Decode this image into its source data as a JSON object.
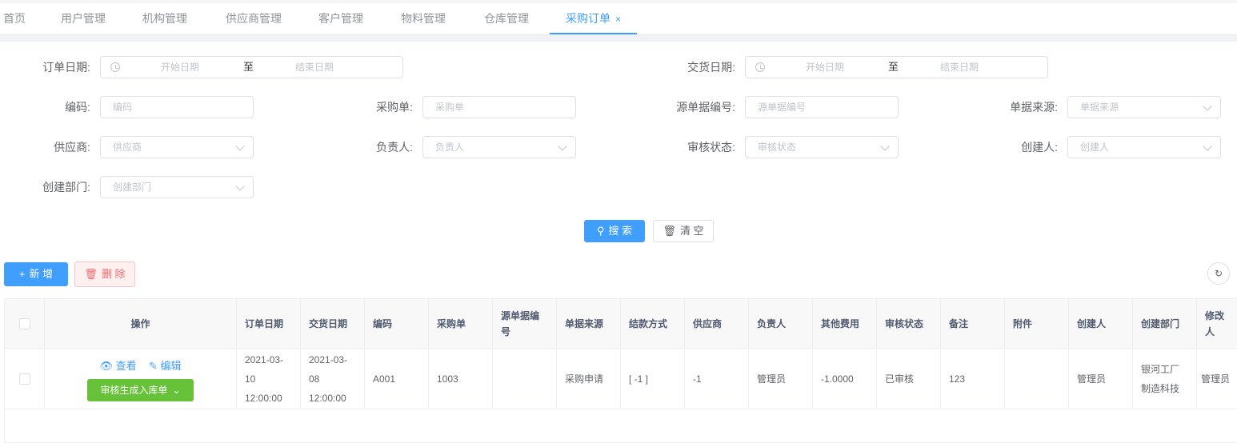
{
  "tabs": [
    {
      "label": "首页"
    },
    {
      "label": "用户管理"
    },
    {
      "label": "机构管理"
    },
    {
      "label": "供应商管理"
    },
    {
      "label": "客户管理"
    },
    {
      "label": "物料管理"
    },
    {
      "label": "仓库管理"
    },
    {
      "label": "采购订单",
      "close": "×"
    }
  ],
  "form": {
    "order_date": {
      "label": "订单日期:",
      "start": "开始日期",
      "sep": "至",
      "end": "结束日期"
    },
    "delivery_date": {
      "label": "交货日期:",
      "start": "开始日期",
      "sep": "至",
      "end": "结束日期"
    },
    "code": {
      "label": "编码:",
      "placeholder": "编码"
    },
    "purchase_no": {
      "label": "采购单:",
      "placeholder": "采购单"
    },
    "source_no": {
      "label": "源单据编号:",
      "placeholder": "源单据编号"
    },
    "source_type": {
      "label": "单据来源:",
      "placeholder": "单据来源"
    },
    "supplier": {
      "label": "供应商:",
      "placeholder": "供应商"
    },
    "owner": {
      "label": "负责人:",
      "placeholder": "负责人"
    },
    "audit_status": {
      "label": "审核状态:",
      "placeholder": "审核状态"
    },
    "creator": {
      "label": "创建人:",
      "placeholder": "创建人"
    },
    "dept": {
      "label": "创建部门:",
      "placeholder": "创建部门"
    },
    "search_label": "搜 索",
    "clear_label": "清 空"
  },
  "toolbar": {
    "add_label": "新 增",
    "delete_label": "删 除"
  },
  "table": {
    "headers": [
      "操作",
      "订单日期",
      "交货日期",
      "编码",
      "采购单",
      "源单据编号",
      "单据来源",
      "结款方式",
      "供应商",
      "负责人",
      "其他费用",
      "审核状态",
      "备注",
      "附件",
      "创建人",
      "创建部门",
      "修改人"
    ],
    "row": {
      "view": "查看",
      "edit": "编辑",
      "generate": "审核生成入库单",
      "order_date": "2021-03-10 12:00:00",
      "delivery_date": "2021-03-08 12:00:00",
      "code": "A001",
      "purchase_no": "1003",
      "source_no": "",
      "source_type": "采购申请",
      "payment": "[ -1 ]",
      "supplier": "-1",
      "owner": "管理员",
      "other_fee": "-1.0000",
      "audit_status": "已审核",
      "remark": "123",
      "attachment": "",
      "creator": "管理员",
      "dept": "银河工厂制造科技",
      "modifier": "管理员"
    }
  },
  "colors": {
    "primary": "#409eff",
    "success": "#67c23a",
    "danger": "#f56c6c"
  }
}
